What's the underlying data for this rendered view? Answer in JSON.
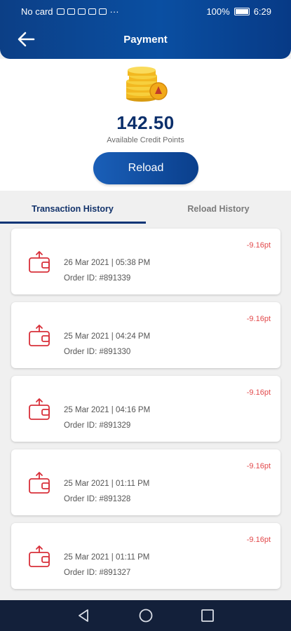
{
  "status_bar": {
    "carrier": "No card",
    "battery": "100%",
    "time": "6:29"
  },
  "header": {
    "title": "Payment"
  },
  "summary": {
    "points": "142.50",
    "points_label": "Available Credit Points",
    "reload_label": "Reload"
  },
  "tabs": [
    {
      "label": "Transaction History",
      "active": true
    },
    {
      "label": "Reload History",
      "active": false
    }
  ],
  "transactions": [
    {
      "date": "26 Mar 2021 | 05:38 PM",
      "order": "Order ID: #891339",
      "amount": "-9.16pt"
    },
    {
      "date": "25 Mar 2021 | 04:24 PM",
      "order": "Order ID: #891330",
      "amount": "-9.16pt"
    },
    {
      "date": "25 Mar 2021 | 04:16 PM",
      "order": "Order ID: #891329",
      "amount": "-9.16pt"
    },
    {
      "date": "25 Mar 2021 | 01:11 PM",
      "order": "Order ID: #891328",
      "amount": "-9.16pt"
    },
    {
      "date": "25 Mar 2021 | 01:11 PM",
      "order": "Order ID: #891327",
      "amount": "-9.16pt"
    }
  ],
  "colors": {
    "brand": "#0b3576",
    "amount": "#e2494b",
    "icon": "#d8303a"
  },
  "icons": {
    "back": "arrow-left-icon",
    "coins": "coins-stack-icon",
    "transaction": "wallet-outgoing-icon",
    "nav_back": "triangle-back-icon",
    "nav_home": "circle-home-icon",
    "nav_recent": "square-recent-icon"
  }
}
